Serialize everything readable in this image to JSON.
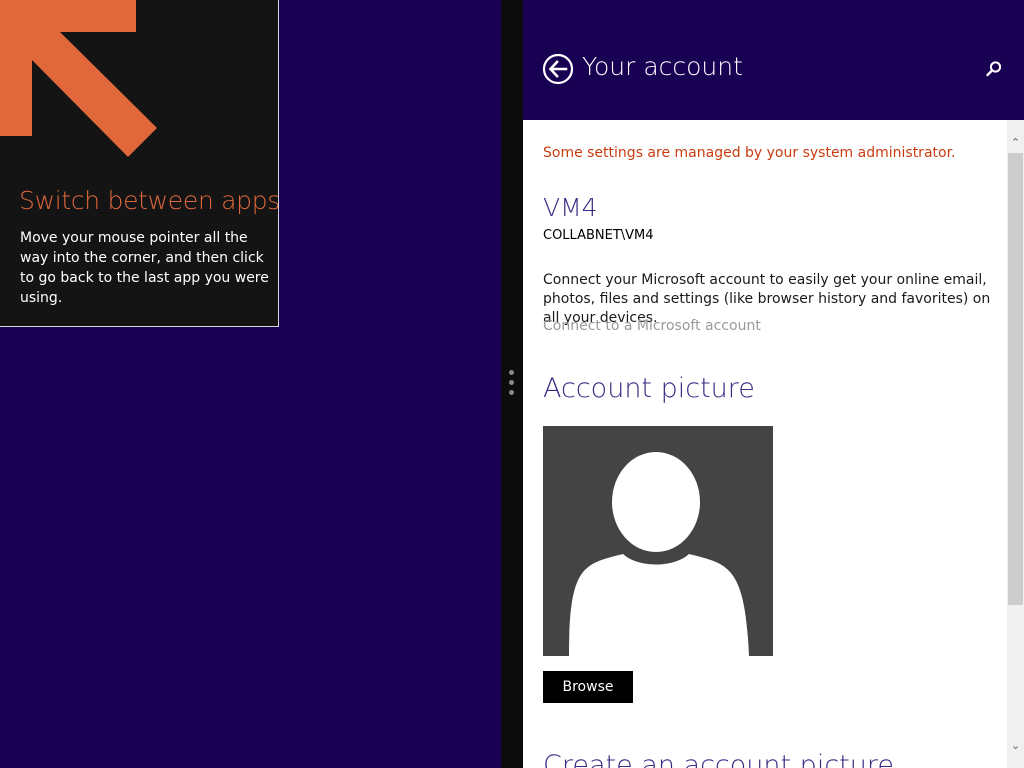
{
  "tip": {
    "title": "Switch between apps",
    "body": "Move your mouse pointer all the way into the corner, and then click to go back to the last app you were using.",
    "arrow_icon": "arrow-up-left-icon",
    "accent_color": "#e0683b"
  },
  "header": {
    "back_icon": "back-arrow-icon",
    "title": "Your account",
    "search_icon": "search-icon"
  },
  "account": {
    "admin_notice": "Some settings are managed by your system administrator.",
    "user_name": "VM4",
    "user_domain": "COLLABNET\\VM4",
    "connect_description": "Connect your Microsoft account to easily get your online email, photos, files and settings (like browser history and favorites) on all your devices.",
    "connect_link": "Connect to a Microsoft account"
  },
  "account_picture": {
    "heading": "Account picture",
    "avatar_icon": "default-user-avatar-icon",
    "browse_label": "Browse"
  },
  "create_picture": {
    "heading": "Create an account picture"
  },
  "scrollbar": {
    "up_icon": "scroll-up-arrow-icon",
    "down_icon": "scroll-down-arrow-icon"
  },
  "colors": {
    "background": "#180052",
    "heading": "#3c2a86",
    "notice": "#c93b0f",
    "link_disabled": "#9a9a9a"
  }
}
